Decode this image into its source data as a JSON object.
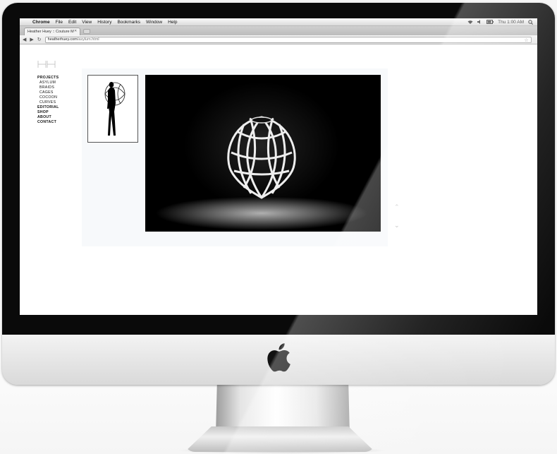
{
  "menubar": {
    "app_name": "Chrome",
    "menus": [
      "File",
      "Edit",
      "View",
      "History",
      "Bookmarks",
      "Window",
      "Help"
    ],
    "clock": "Thu 1:00 AM"
  },
  "browser": {
    "tab_title": "Heather Huey :: Couture M",
    "url_domain": "heatherhuey.com",
    "url_path": "/asylum.html"
  },
  "site": {
    "nav": {
      "projects": "PROJECTS",
      "sub": [
        "ASYLUM",
        "BRAIDS",
        "CAGES",
        "COCOON",
        "CURVES"
      ],
      "editorial": "EDITORIAL",
      "shop": "SHOP",
      "about": "ABOUT",
      "contact": "CONTACT"
    }
  },
  "icons": {
    "apple_menu": "apple-icon",
    "wifi": "wifi-icon",
    "volume": "volume-icon",
    "battery": "battery-icon",
    "search": "search-icon",
    "back": "back-arrow-icon",
    "forward": "forward-arrow-icon",
    "reload": "reload-icon",
    "bookmark": "star-icon",
    "prev": "chevron-up-icon",
    "next": "chevron-down-icon"
  }
}
